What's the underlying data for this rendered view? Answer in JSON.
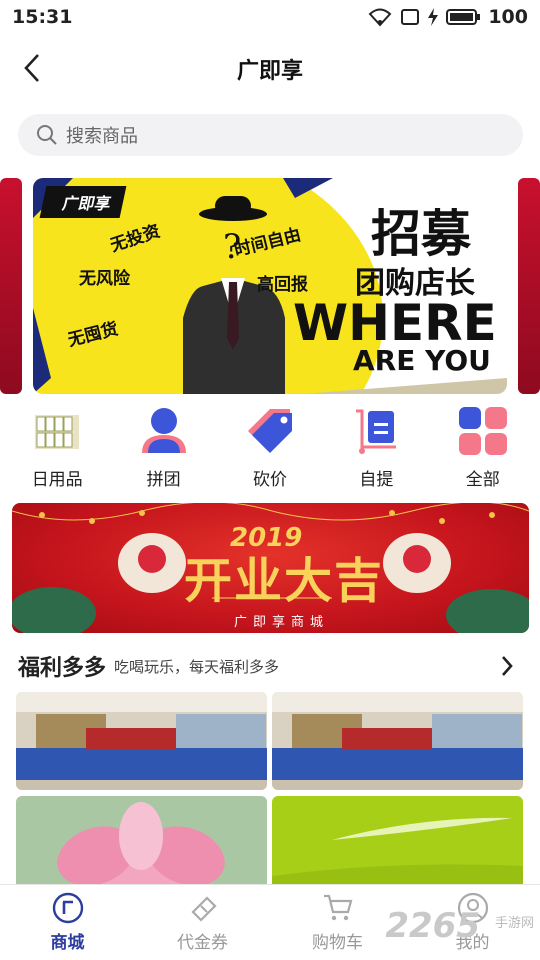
{
  "status": {
    "time": "15:31",
    "battery": "100"
  },
  "nav": {
    "title": "广即享"
  },
  "search": {
    "placeholder": "搜索商品"
  },
  "banner": {
    "logo": "广即享",
    "tags": [
      "无投资",
      "无风险",
      "无囤货",
      "时间自由",
      "高回报"
    ],
    "headline1": "招募",
    "headline2": "团购店长",
    "headline3": "WHERE",
    "headline4": "ARE YOU"
  },
  "categories": [
    {
      "label": "日用品",
      "icon": "daily-goods-icon"
    },
    {
      "label": "拼团",
      "icon": "group-buy-icon"
    },
    {
      "label": "砍价",
      "icon": "bargain-tag-icon"
    },
    {
      "label": "自提",
      "icon": "self-pickup-icon"
    },
    {
      "label": "全部",
      "icon": "all-grid-icon"
    }
  ],
  "promo": {
    "year": "2019",
    "main": "开业大吉",
    "sub": "广即享商城"
  },
  "section": {
    "title": "福利多多",
    "subtitle": "吃喝玩乐，每天福利多多"
  },
  "tabs": [
    {
      "label": "商城",
      "icon": "mall-icon",
      "active": true
    },
    {
      "label": "代金券",
      "icon": "voucher-icon",
      "active": false
    },
    {
      "label": "购物车",
      "icon": "cart-icon",
      "active": false
    },
    {
      "label": "我的",
      "icon": "profile-icon",
      "active": false
    }
  ],
  "watermark": {
    "brand": "2265",
    "sub": "手游网"
  },
  "colors": {
    "accent": "#2c3d9e",
    "banner_yellow": "#f7e41c",
    "promo_red": "#c4141c",
    "icon_blue": "#3d55d8",
    "icon_pink": "#f5788a"
  }
}
